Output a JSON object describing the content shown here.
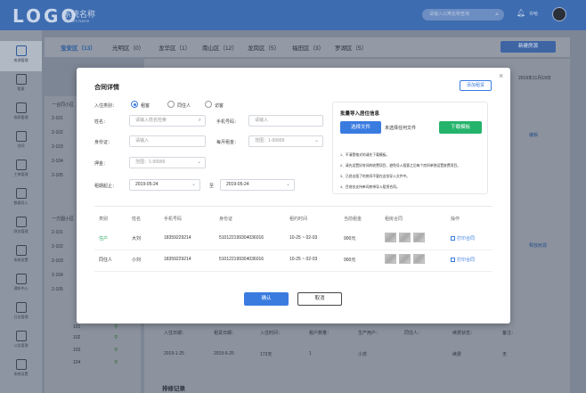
{
  "app": {
    "logo": "LOGO",
    "system_name": "系统名称",
    "system_name_en": "System Name",
    "search_placeholder": "请输入公寓名称查询",
    "user_name": "许哈"
  },
  "colors": {
    "primary": "#3a7be0",
    "success": "#24b36b",
    "topbar": "#3e6cb0"
  },
  "sidebar": {
    "items": [
      {
        "label": "房源管理",
        "icon": "building-icon"
      },
      {
        "label": "租客",
        "icon": "tenant-icon"
      },
      {
        "label": "收款管理",
        "icon": "payment-icon"
      },
      {
        "label": "合同",
        "icon": "contract-icon"
      },
      {
        "label": "工单管理",
        "icon": "workorder-icon"
      },
      {
        "label": "数据导入",
        "icon": "import-icon"
      },
      {
        "label": "财务管理",
        "icon": "finance-icon"
      },
      {
        "label": "系统设置",
        "icon": "settings-icon"
      },
      {
        "label": "通知中心",
        "icon": "notice-icon"
      },
      {
        "label": "日志管理",
        "icon": "log-icon"
      },
      {
        "label": "公告管理",
        "icon": "announce-icon"
      },
      {
        "label": "系统设置",
        "icon": "system-icon"
      }
    ]
  },
  "tabs": [
    {
      "label": "宝安区（13）"
    },
    {
      "label": "光明区（0）"
    },
    {
      "label": "龙华区（1）"
    },
    {
      "label": "南山区（12）"
    },
    {
      "label": "龙岗区（5）"
    },
    {
      "label": "福田区（3）"
    },
    {
      "label": "罗湖区（5）"
    }
  ],
  "new_listing_button": "新建房源",
  "tree": [
    "一合同小区",
    "2-101",
    "2-102",
    "2-103",
    "2-104",
    "2-105",
    "一方圆小区",
    "2-101",
    "2-102",
    "2-103",
    "2-104",
    "2-105",
    "101",
    "102",
    "103",
    "104"
  ],
  "background": {
    "update_time": "2019年11月19日",
    "edit_link": "编辑",
    "release_link": "释放房源",
    "stats_headers": [
      "入住日期：",
      "租赁日期：",
      "入住时间：",
      "租户数量：",
      "生产用户：",
      "同住人：",
      "续费状态：",
      "备注："
    ],
    "stats_values": [
      "2019-1-25",
      "2019-6-25",
      "173天",
      "1",
      "小苏",
      "",
      "续费",
      "无"
    ],
    "history_title": "排修记录"
  },
  "modal": {
    "title": "合同详情",
    "add_button": "添加租赁",
    "form": {
      "type_label": "入住类别：",
      "type_options": [
        "租客",
        "同住人",
        "访客"
      ],
      "name_label": "姓名：",
      "name_placeholder": "请输入姓名检索",
      "phone_label": "手机号码：",
      "phone_placeholder": "请输入",
      "id_label": "身份证：",
      "id_placeholder": "请输入",
      "rent_label": "每月租金：",
      "rent_placeholder": "范围：1-99999",
      "deposit_label": "押金：",
      "deposit_placeholder": "范围：1-99999",
      "period_label": "租期起止：",
      "start_date": "2019-05-24",
      "to": "至",
      "end_date": "2019-05-24"
    },
    "upload": {
      "title": "批量导入居住信息",
      "choose_button": "选择文件",
      "no_file": "未选择任何文件",
      "template_button": "下载模板",
      "notes": [
        "1、不清楚格式的请先下载模板。",
        "2、请先设置好房间的收费项目，避免导入租客之后每个房间单独设置收费项目。",
        "3、已经出租了的房间不要在这张导入文件中。",
        "4、目前仅支持单间房带导入租赁合同。"
      ]
    },
    "table": {
      "headers": [
        "类别",
        "姓名",
        "手机号码",
        "身份证",
        "租约时间",
        "当前租金",
        "租房合同",
        "操作"
      ],
      "rows": [
        {
          "type": "住户",
          "name": "大刘",
          "phone": "18359229214",
          "id": "510122199304036016",
          "period": "10-25 ~ 02-03",
          "rent": "900元",
          "action": "打印合同"
        },
        {
          "type": "同住人",
          "name": "小刘",
          "phone": "18359229214",
          "id": "510122199304036016",
          "period": "10-25 ~ 02-03",
          "rent": "900元",
          "action": "打印合同"
        }
      ]
    },
    "ok_button": "确认",
    "cancel_button": "取消"
  }
}
